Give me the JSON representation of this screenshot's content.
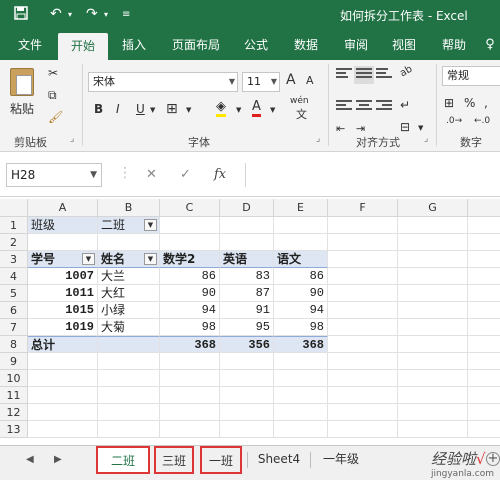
{
  "titlebar": {
    "title": "如何拆分工作表 - Excel"
  },
  "tabs": [
    "文件",
    "开始",
    "插入",
    "页面布局",
    "公式",
    "数据",
    "审阅",
    "视图",
    "帮助"
  ],
  "ribbon": {
    "paste_label": "粘贴",
    "clipboard_label": "剪贴板",
    "font_name": "宋体",
    "font_size": "11",
    "font_group_label": "字体",
    "align_group_label": "对齐方式",
    "number_format": "常规",
    "number_group_label": "数字",
    "pinyin": "wén",
    "bold": "B",
    "italic": "I",
    "underline": "U",
    "grow": "A",
    "shrink": "A"
  },
  "formula_bar": {
    "name_box": "H28",
    "cancel": "✕",
    "enter": "✓",
    "fx": "fx",
    "value": ""
  },
  "grid": {
    "columns": [
      "A",
      "B",
      "C",
      "D",
      "E",
      "F",
      "G"
    ],
    "rows": [
      "1",
      "2",
      "3",
      "4",
      "5",
      "6",
      "7",
      "8",
      "9",
      "10",
      "11",
      "12",
      "13"
    ],
    "r1": {
      "a": "班级",
      "b": "二班"
    },
    "r3": {
      "a": "学号",
      "b": "姓名",
      "c": "数学2",
      "d": "英语",
      "e": "语文"
    },
    "data": [
      {
        "id": "1007",
        "name": "大兰",
        "math": "86",
        "eng": "83",
        "chn": "86"
      },
      {
        "id": "1011",
        "name": "大红",
        "math": "90",
        "eng": "87",
        "chn": "90"
      },
      {
        "id": "1015",
        "name": "小绿",
        "math": "94",
        "eng": "91",
        "chn": "94"
      },
      {
        "id": "1019",
        "name": "大菊",
        "math": "98",
        "eng": "95",
        "chn": "98"
      }
    ],
    "total": {
      "label": "总计",
      "math": "368",
      "eng": "356",
      "chn": "368"
    }
  },
  "sheets": [
    "二班",
    "三班",
    "一班",
    "Sheet4",
    "一年级"
  ],
  "active_sheet": "二班",
  "watermark": {
    "text": "经验啦",
    "check": "√",
    "url": "jingyanla.com"
  },
  "colors": {
    "excel_green": "#217346",
    "tab_highlight": "#e03535",
    "pivot_blue": "#dde6f2"
  }
}
